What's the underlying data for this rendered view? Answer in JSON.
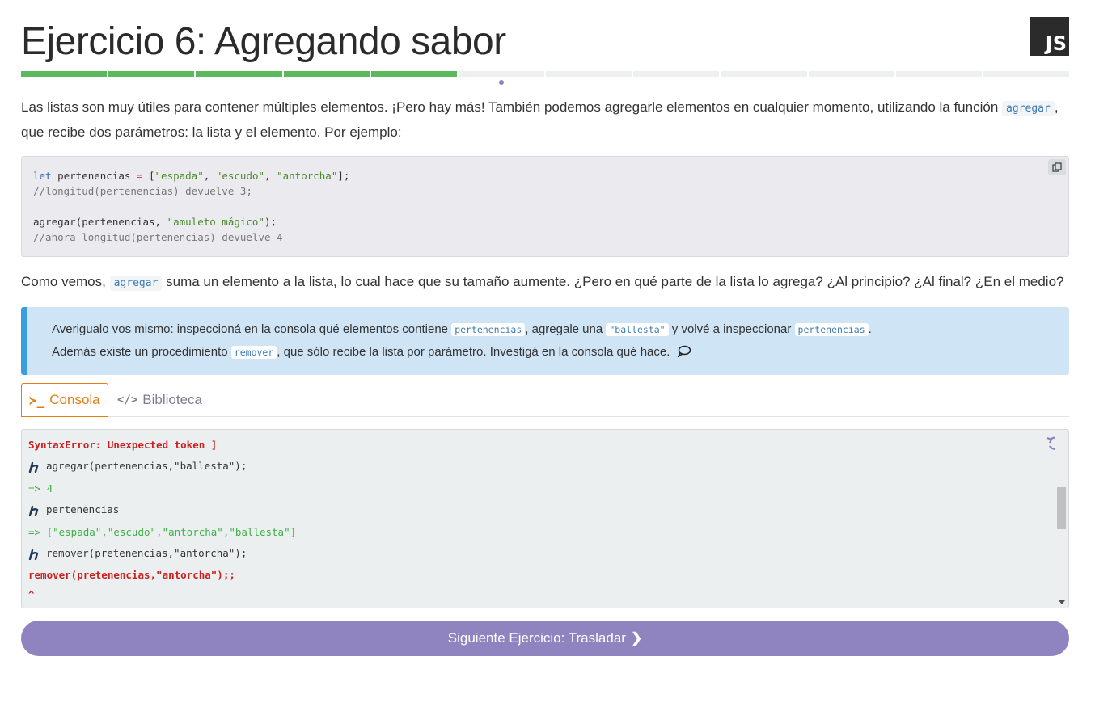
{
  "header": {
    "title": "Ejercicio 6: Agregando sabor",
    "logo_text": "JS"
  },
  "progress": {
    "total_segments": 12,
    "completed_segments": 5,
    "current_segment": 6,
    "done_color": "#5cb85c",
    "pending_color": "#eef0f0"
  },
  "intro": {
    "text1": "Las listas son muy útiles para contener múltiples elementos. ¡Pero hay más! También podemos agregarle elementos en cualquier momento, utilizando la función ",
    "code1": "agregar",
    "text2": ", que recibe dos parámetros: la lista y el elemento. Por ejemplo:"
  },
  "example_code": {
    "line1_kw": "let",
    "line1_var": " pertenencias ",
    "line1_op": "=",
    "line1_open": " [",
    "line1_s1": "\"espada\"",
    "line1_sep1": ", ",
    "line1_s2": "\"escudo\"",
    "line1_sep2": ", ",
    "line1_s3": "\"antorcha\"",
    "line1_close": "];",
    "line2": "//longitud(pertenencias) devuelve 3;",
    "line4_pre": "agregar(pertenencias, ",
    "line4_str": "\"amuleto mágico\"",
    "line4_post": ");",
    "line5": "//ahora longitud(pertenencias) devuelve 4",
    "copy_icon": "copy-icon"
  },
  "explanation": {
    "text1": "Como vemos, ",
    "code1": "agregar",
    "text2": " suma un elemento a la lista, lo cual hace que su tamaño aumente. ¿Pero en qué parte de la lista lo agrega? ¿Al principio? ¿Al final? ¿En el medio?"
  },
  "tip": {
    "l1_a": "Averigualo vos mismo: inspeccioná en la consola qué elementos contiene ",
    "l1_code1": "pertenencias",
    "l1_b": ", agregale una ",
    "l1_code2": "\"ballesta\"",
    "l1_c": " y volvé a inspeccionar ",
    "l1_code3": "pertenencias",
    "l1_d": ".",
    "l2_a": "Además existe un procedimiento ",
    "l2_code1": "remover",
    "l2_b": ", que sólo recibe la lista por parámetro. Investigá en la consola qué hace.",
    "accent_color": "#3a9de0"
  },
  "tabs": {
    "console_icon": "≻_",
    "console_label": "Consola",
    "library_icon": "</>",
    "library_label": "Biblioteca"
  },
  "console": {
    "lines": [
      {
        "type": "error",
        "text": "SyntaxError: Unexpected token ]"
      },
      {
        "type": "input",
        "text": "agregar(pertenencias,\"ballesta\");"
      },
      {
        "type": "result",
        "text": "=> 4"
      },
      {
        "type": "input",
        "text": "pertenencias"
      },
      {
        "type": "result",
        "text": "=> [\"espada\",\"escudo\",\"antorcha\",\"ballesta\"]"
      },
      {
        "type": "input",
        "text": "remover(pretenencias,\"antorcha\");"
      },
      {
        "type": "error",
        "text": "remover(pretenencias,\"antorcha\");;"
      },
      {
        "type": "caret",
        "text": "^"
      }
    ]
  },
  "next_button": {
    "label": "Siguiente Ejercicio: Trasladar",
    "color": "#8f84bf"
  }
}
